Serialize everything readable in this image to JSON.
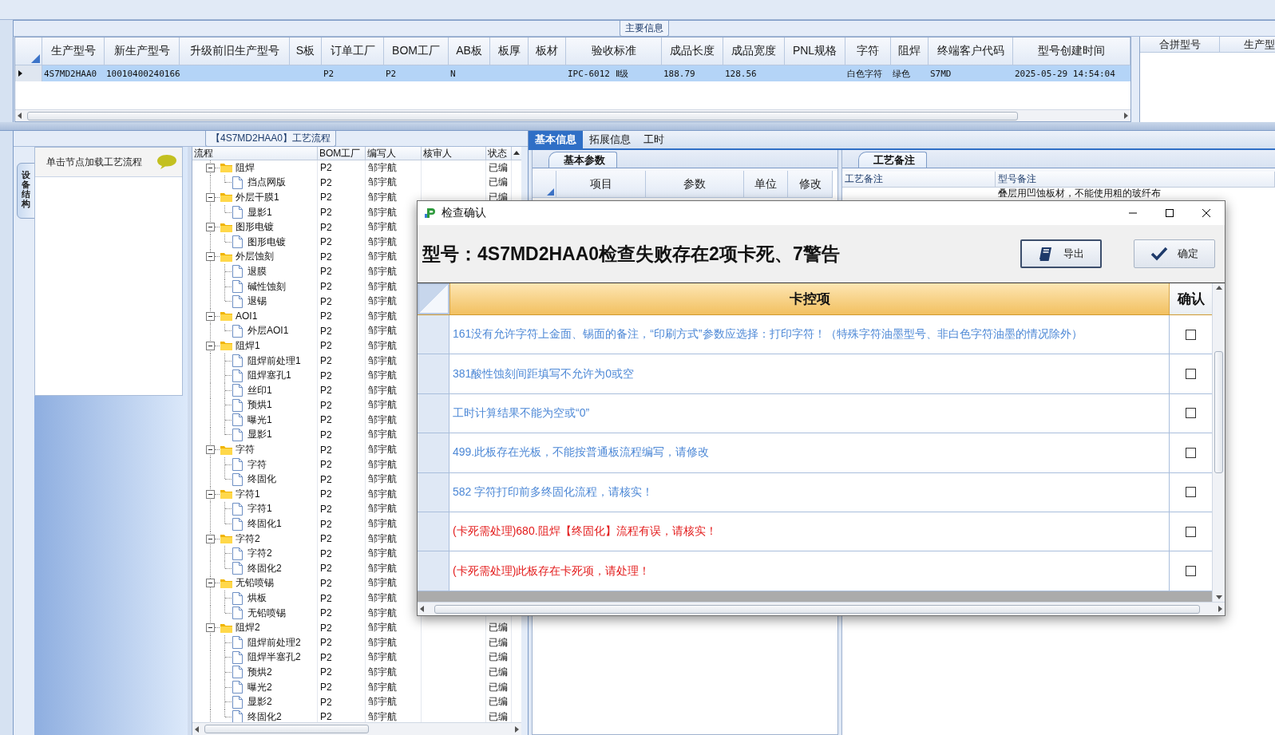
{
  "main_info": {
    "title": "主要信息",
    "columns": [
      "生产型号",
      "新生产型号",
      "升级前旧生产型号",
      "S板",
      "订单工厂",
      "BOM工厂",
      "AB板",
      "板厚",
      "板材",
      "验收标准",
      "成品长度",
      "成品宽度",
      "PNL规格",
      "字符",
      "阻焊",
      "终端客户代码",
      "型号创建时间"
    ],
    "rows": [
      {
        "selected": true,
        "cells": [
          "4S7MD2HAA0",
          "10010400240166",
          null,
          null,
          "P2",
          "P2",
          "N",
          null,
          null,
          "IPC-6012 Ⅱ级",
          "188.79",
          "128.56",
          null,
          "白色字符",
          "绿色",
          "S7MD",
          "2025-05-29 14:54:04"
        ]
      }
    ],
    "side_columns": [
      "合拼型号",
      "生产型"
    ]
  },
  "process": {
    "title": "【4S7MD2HAA0】工艺流程",
    "side_tab": "设备结构",
    "hint": "单击节点加载工艺流程",
    "columns": [
      "流程",
      "BOM工厂",
      "编写人",
      "核审人",
      "状态"
    ],
    "tree": [
      {
        "name": "阻焊",
        "bom": "P2",
        "author": "邹宇航",
        "status": "已编",
        "expanded": true,
        "children": [
          {
            "name": "挡点网版",
            "bom": "P2",
            "author": "邹宇航",
            "status": "已编"
          }
        ]
      },
      {
        "name": "外层干膜1",
        "bom": "P2",
        "author": "邹宇航",
        "status": "已编",
        "expanded": true,
        "children": [
          {
            "name": "显影1",
            "bom": "P2",
            "author": "邹宇航"
          }
        ]
      },
      {
        "name": "图形电镀",
        "bom": "P2",
        "author": "邹宇航",
        "expanded": true,
        "children": [
          {
            "name": "图形电镀",
            "bom": "P2",
            "author": "邹宇航"
          }
        ]
      },
      {
        "name": "外层蚀刻",
        "bom": "P2",
        "author": "邹宇航",
        "expanded": true,
        "children": [
          {
            "name": "退膜",
            "bom": "P2",
            "author": "邹宇航"
          },
          {
            "name": "碱性蚀刻",
            "bom": "P2",
            "author": "邹宇航"
          },
          {
            "name": "退锡",
            "bom": "P2",
            "author": "邹宇航"
          }
        ]
      },
      {
        "name": "AOI1",
        "bom": "P2",
        "author": "邹宇航",
        "expanded": true,
        "children": [
          {
            "name": "外层AOI1",
            "bom": "P2",
            "author": "邹宇航"
          }
        ]
      },
      {
        "name": "阻焊1",
        "bom": "P2",
        "author": "邹宇航",
        "expanded": true,
        "children": [
          {
            "name": "阻焊前处理1",
            "bom": "P2",
            "author": "邹宇航"
          },
          {
            "name": "阻焊塞孔1",
            "bom": "P2",
            "author": "邹宇航"
          },
          {
            "name": "丝印1",
            "bom": "P2",
            "author": "邹宇航"
          },
          {
            "name": "预烘1",
            "bom": "P2",
            "author": "邹宇航"
          },
          {
            "name": "曝光1",
            "bom": "P2",
            "author": "邹宇航"
          },
          {
            "name": "显影1",
            "bom": "P2",
            "author": "邹宇航"
          }
        ]
      },
      {
        "name": "字符",
        "bom": "P2",
        "author": "邹宇航",
        "expanded": true,
        "children": [
          {
            "name": "字符",
            "bom": "P2",
            "author": "邹宇航"
          },
          {
            "name": "终固化",
            "bom": "P2",
            "author": "邹宇航"
          }
        ]
      },
      {
        "name": "字符1",
        "bom": "P2",
        "author": "邹宇航",
        "expanded": true,
        "children": [
          {
            "name": "字符1",
            "bom": "P2",
            "author": "邹宇航"
          },
          {
            "name": "终固化1",
            "bom": "P2",
            "author": "邹宇航"
          }
        ]
      },
      {
        "name": "字符2",
        "bom": "P2",
        "author": "邹宇航",
        "expanded": true,
        "children": [
          {
            "name": "字符2",
            "bom": "P2",
            "author": "邹宇航"
          },
          {
            "name": "终固化2",
            "bom": "P2",
            "author": "邹宇航"
          }
        ]
      },
      {
        "name": "无铅喷锡",
        "bom": "P2",
        "author": "邹宇航",
        "expanded": true,
        "children": [
          {
            "name": "烘板",
            "bom": "P2",
            "author": "邹宇航"
          },
          {
            "name": "无铅喷锡",
            "bom": "P2",
            "author": "邹宇航"
          }
        ]
      },
      {
        "name": "阻焊2",
        "bom": "P2",
        "author": "邹宇航",
        "status": "已编",
        "expanded": true,
        "children": [
          {
            "name": "阻焊前处理2",
            "bom": "P2",
            "author": "邹宇航",
            "status": "已编"
          },
          {
            "name": "阻焊半塞孔2",
            "bom": "P2",
            "author": "邹宇航",
            "status": "已编"
          },
          {
            "name": "预烘2",
            "bom": "P2",
            "author": "邹宇航",
            "status": "已编"
          },
          {
            "name": "曝光2",
            "bom": "P2",
            "author": "邹宇航",
            "status": "已编"
          },
          {
            "name": "显影2",
            "bom": "P2",
            "author": "邹宇航",
            "status": "已编"
          },
          {
            "name": "终固化2",
            "bom": "P2",
            "author": "邹宇航",
            "status": "已编"
          }
        ]
      }
    ]
  },
  "detail": {
    "tabs": [
      {
        "label": "基本信息",
        "selected": true
      },
      {
        "label": "拓展信息",
        "selected": false
      },
      {
        "label": "工时",
        "selected": false
      }
    ],
    "params": {
      "tab": "基本参数",
      "columns": [
        "项目",
        "参数",
        "单位",
        "修改"
      ]
    },
    "notes": {
      "tab": "工艺备注",
      "columns": [
        "工艺备注",
        "型号备注"
      ],
      "rows": [
        {
          "cells": [
            null,
            "叠层用凹蚀板材，不能使用粗的玻纤布"
          ]
        }
      ]
    }
  },
  "dialog": {
    "title": "检查确认",
    "heading": "型号：4S7MD2HAA0检查失败存在2项卡死、7警告",
    "buttons": [
      {
        "label": "导出",
        "kind": "export"
      },
      {
        "label": "确定",
        "kind": "ok"
      }
    ],
    "columns": [
      "卡控项",
      "确认"
    ],
    "rows": [
      {
        "text": "161没有允许字符上金面、锡面的备注，“印刷方式”参数应选择：打印字符！（特殊字符油墨型号、非白色字符油墨的情况除外）",
        "kind": "warning",
        "confirmed": false
      },
      {
        "text": "381酸性蚀刻间距填写不允许为0或空",
        "kind": "warning",
        "confirmed": false
      },
      {
        "text": "工时计算结果不能为空或“0”",
        "kind": "warning",
        "confirmed": false
      },
      {
        "text": "499.此板存在光板，不能按普通板流程编写，请修改",
        "kind": "warning",
        "confirmed": false
      },
      {
        "text": "582 字符打印前多终固化流程，请核实！",
        "kind": "warning",
        "confirmed": false
      },
      {
        "text": "(卡死需处理)680.阻焊【终固化】流程有误，请核实！",
        "kind": "fatal",
        "confirmed": false
      },
      {
        "text": "(卡死需处理)此板存在卡死项，请处理！",
        "kind": "fatal",
        "confirmed": false
      }
    ]
  }
}
